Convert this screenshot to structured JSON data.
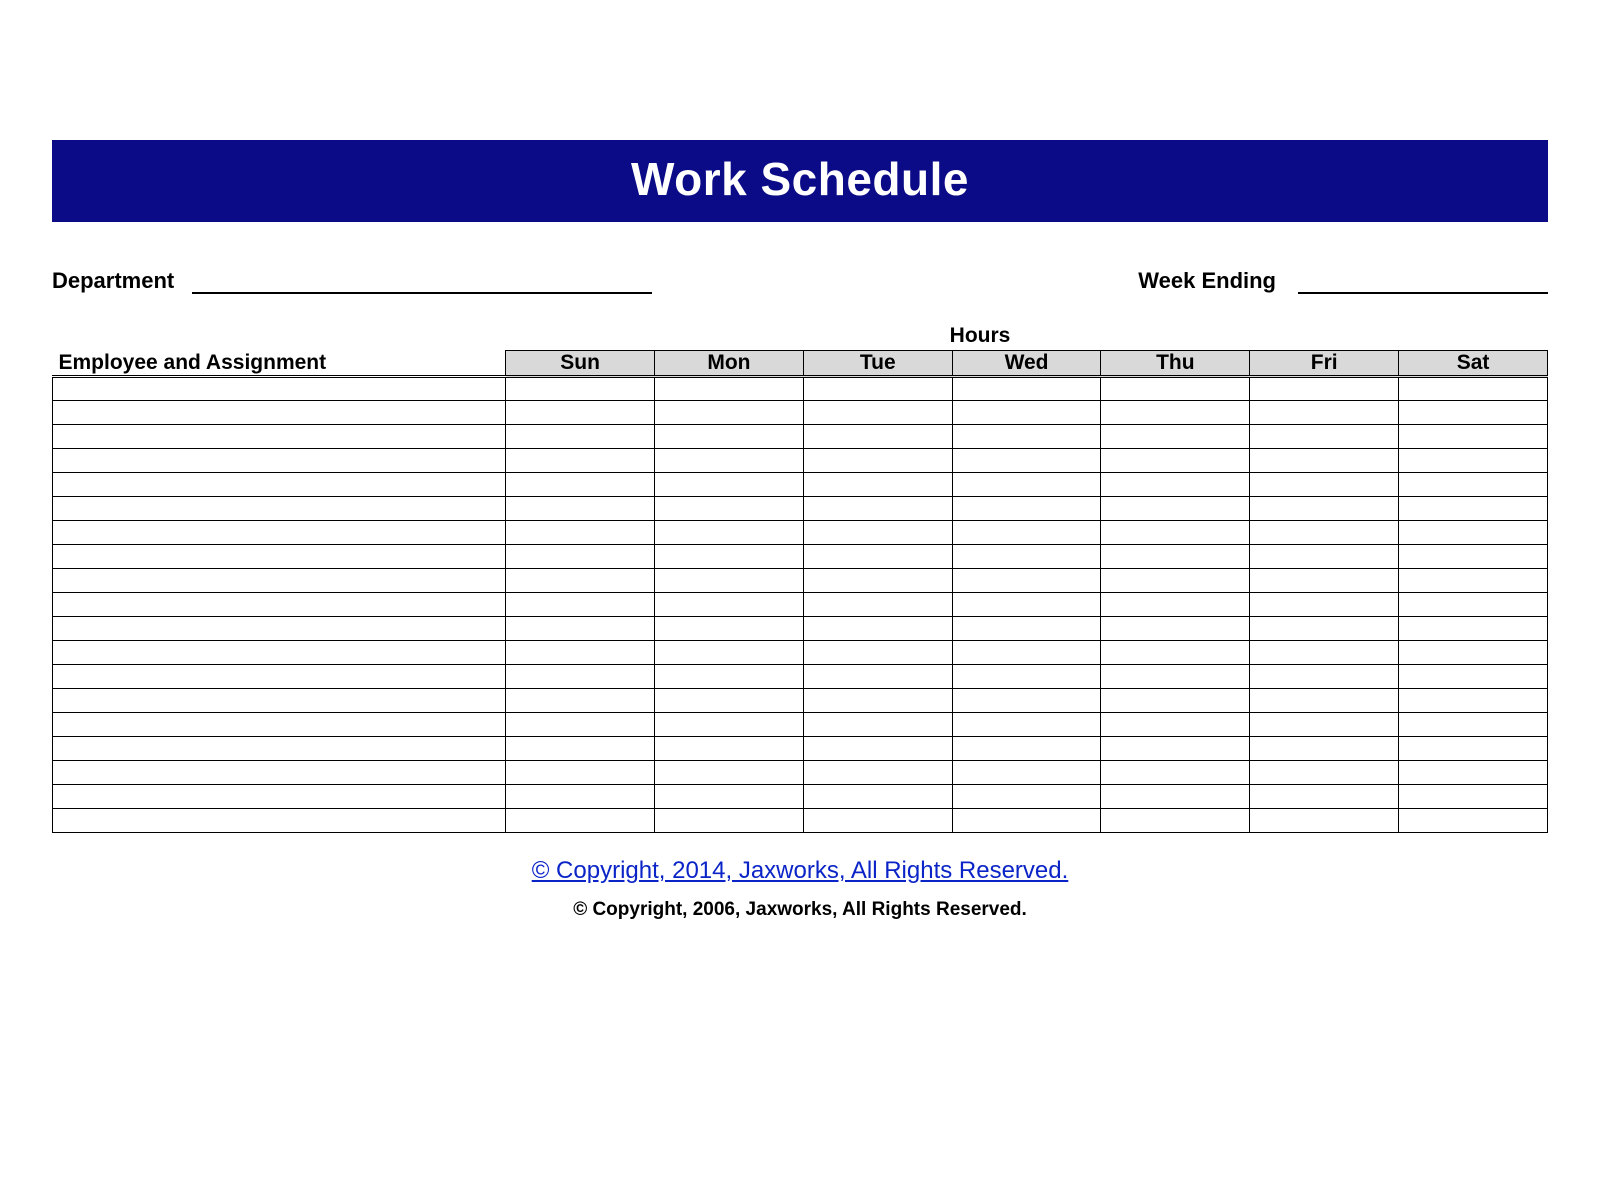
{
  "title": "Work Schedule",
  "meta": {
    "department_label": "Department",
    "department_value": "",
    "week_ending_label": "Week Ending",
    "week_ending_value": ""
  },
  "hours_label": "Hours",
  "columns": {
    "employee": "Employee and Assignment",
    "days": [
      "Sun",
      "Mon",
      "Tue",
      "Wed",
      "Thu",
      "Fri",
      "Sat"
    ]
  },
  "rows": [
    {
      "employee": "",
      "hours": [
        "",
        "",
        "",
        "",
        "",
        "",
        ""
      ]
    },
    {
      "employee": "",
      "hours": [
        "",
        "",
        "",
        "",
        "",
        "",
        ""
      ]
    },
    {
      "employee": "",
      "hours": [
        "",
        "",
        "",
        "",
        "",
        "",
        ""
      ]
    },
    {
      "employee": "",
      "hours": [
        "",
        "",
        "",
        "",
        "",
        "",
        ""
      ]
    },
    {
      "employee": "",
      "hours": [
        "",
        "",
        "",
        "",
        "",
        "",
        ""
      ]
    },
    {
      "employee": "",
      "hours": [
        "",
        "",
        "",
        "",
        "",
        "",
        ""
      ]
    },
    {
      "employee": "",
      "hours": [
        "",
        "",
        "",
        "",
        "",
        "",
        ""
      ]
    },
    {
      "employee": "",
      "hours": [
        "",
        "",
        "",
        "",
        "",
        "",
        ""
      ]
    },
    {
      "employee": "",
      "hours": [
        "",
        "",
        "",
        "",
        "",
        "",
        ""
      ]
    },
    {
      "employee": "",
      "hours": [
        "",
        "",
        "",
        "",
        "",
        "",
        ""
      ]
    },
    {
      "employee": "",
      "hours": [
        "",
        "",
        "",
        "",
        "",
        "",
        ""
      ]
    },
    {
      "employee": "",
      "hours": [
        "",
        "",
        "",
        "",
        "",
        "",
        ""
      ]
    },
    {
      "employee": "",
      "hours": [
        "",
        "",
        "",
        "",
        "",
        "",
        ""
      ]
    },
    {
      "employee": "",
      "hours": [
        "",
        "",
        "",
        "",
        "",
        "",
        ""
      ]
    },
    {
      "employee": "",
      "hours": [
        "",
        "",
        "",
        "",
        "",
        "",
        ""
      ]
    },
    {
      "employee": "",
      "hours": [
        "",
        "",
        "",
        "",
        "",
        "",
        ""
      ]
    },
    {
      "employee": "",
      "hours": [
        "",
        "",
        "",
        "",
        "",
        "",
        ""
      ]
    },
    {
      "employee": "",
      "hours": [
        "",
        "",
        "",
        "",
        "",
        "",
        ""
      ]
    },
    {
      "employee": "",
      "hours": [
        "",
        "",
        "",
        "",
        "",
        "",
        ""
      ]
    }
  ],
  "footer": {
    "link_text": "© Copyright, 2014, Jaxworks, All Rights Reserved.",
    "sub_text": "© Copyright, 2006, Jaxworks, All Rights Reserved."
  }
}
